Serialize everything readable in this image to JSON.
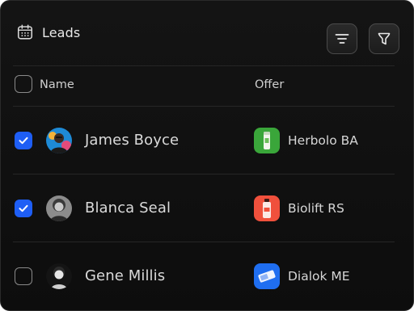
{
  "header": {
    "title": "Leads",
    "icon": "calendar-icon",
    "tools": [
      {
        "name": "sort",
        "icon": "sort-lines-icon"
      },
      {
        "name": "filter",
        "icon": "filter-funnel-icon"
      }
    ]
  },
  "columns": {
    "name": "Name",
    "offer": "Offer"
  },
  "rows": [
    {
      "name": "James Boyce",
      "checked": true,
      "offer": "Herbolo BA",
      "offer_color": "#3aa63a"
    },
    {
      "name": "Blanca Seal",
      "checked": true,
      "offer": "Biolift RS",
      "offer_color": "#f0503c"
    },
    {
      "name": "Gene Millis",
      "checked": false,
      "offer": "Dialok ME",
      "offer_color": "#1f6ef0"
    }
  ],
  "colors": {
    "background": "#111111",
    "accent": "#1e5ef5",
    "text": "#e0e0e0"
  }
}
